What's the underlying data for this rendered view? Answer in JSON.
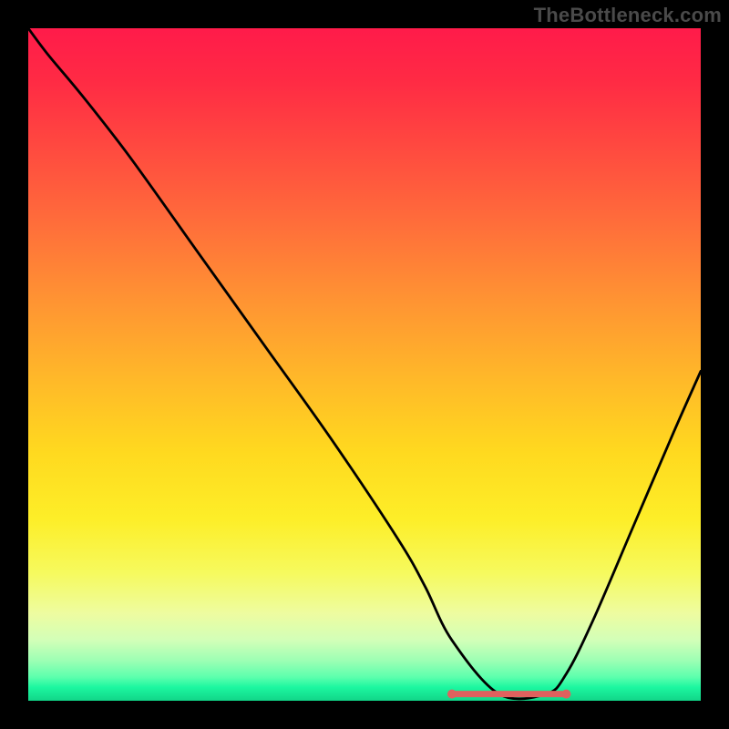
{
  "watermark": "TheBottleneck.com",
  "colors": {
    "curve": "#000000",
    "highlight": "#e0615e",
    "gradient_top": "#ff1b4a",
    "gradient_bottom": "#11d588"
  },
  "chart_data": {
    "type": "line",
    "title": "",
    "xlabel": "",
    "ylabel": "",
    "xlim": [
      0,
      100
    ],
    "ylim": [
      0,
      100
    ],
    "note": "y = bottleneck severity percent (0 at bottom/green, 100 at top/red). x = relative component balance. Values estimated from pixel positions on a 738x738 plot.",
    "series": [
      {
        "name": "bottleneck_curve",
        "x": [
          0,
          3,
          8,
          15,
          25,
          35,
          45,
          55,
          59,
          63,
          70,
          77,
          80,
          84,
          90,
          96,
          100
        ],
        "y": [
          100,
          96,
          90,
          81,
          67,
          53,
          39,
          24,
          17,
          9,
          1,
          1,
          4,
          12,
          26,
          40,
          49
        ]
      }
    ],
    "optimal_range": {
      "x_start": 63,
      "x_end": 80,
      "y": 1
    },
    "annotations": []
  }
}
